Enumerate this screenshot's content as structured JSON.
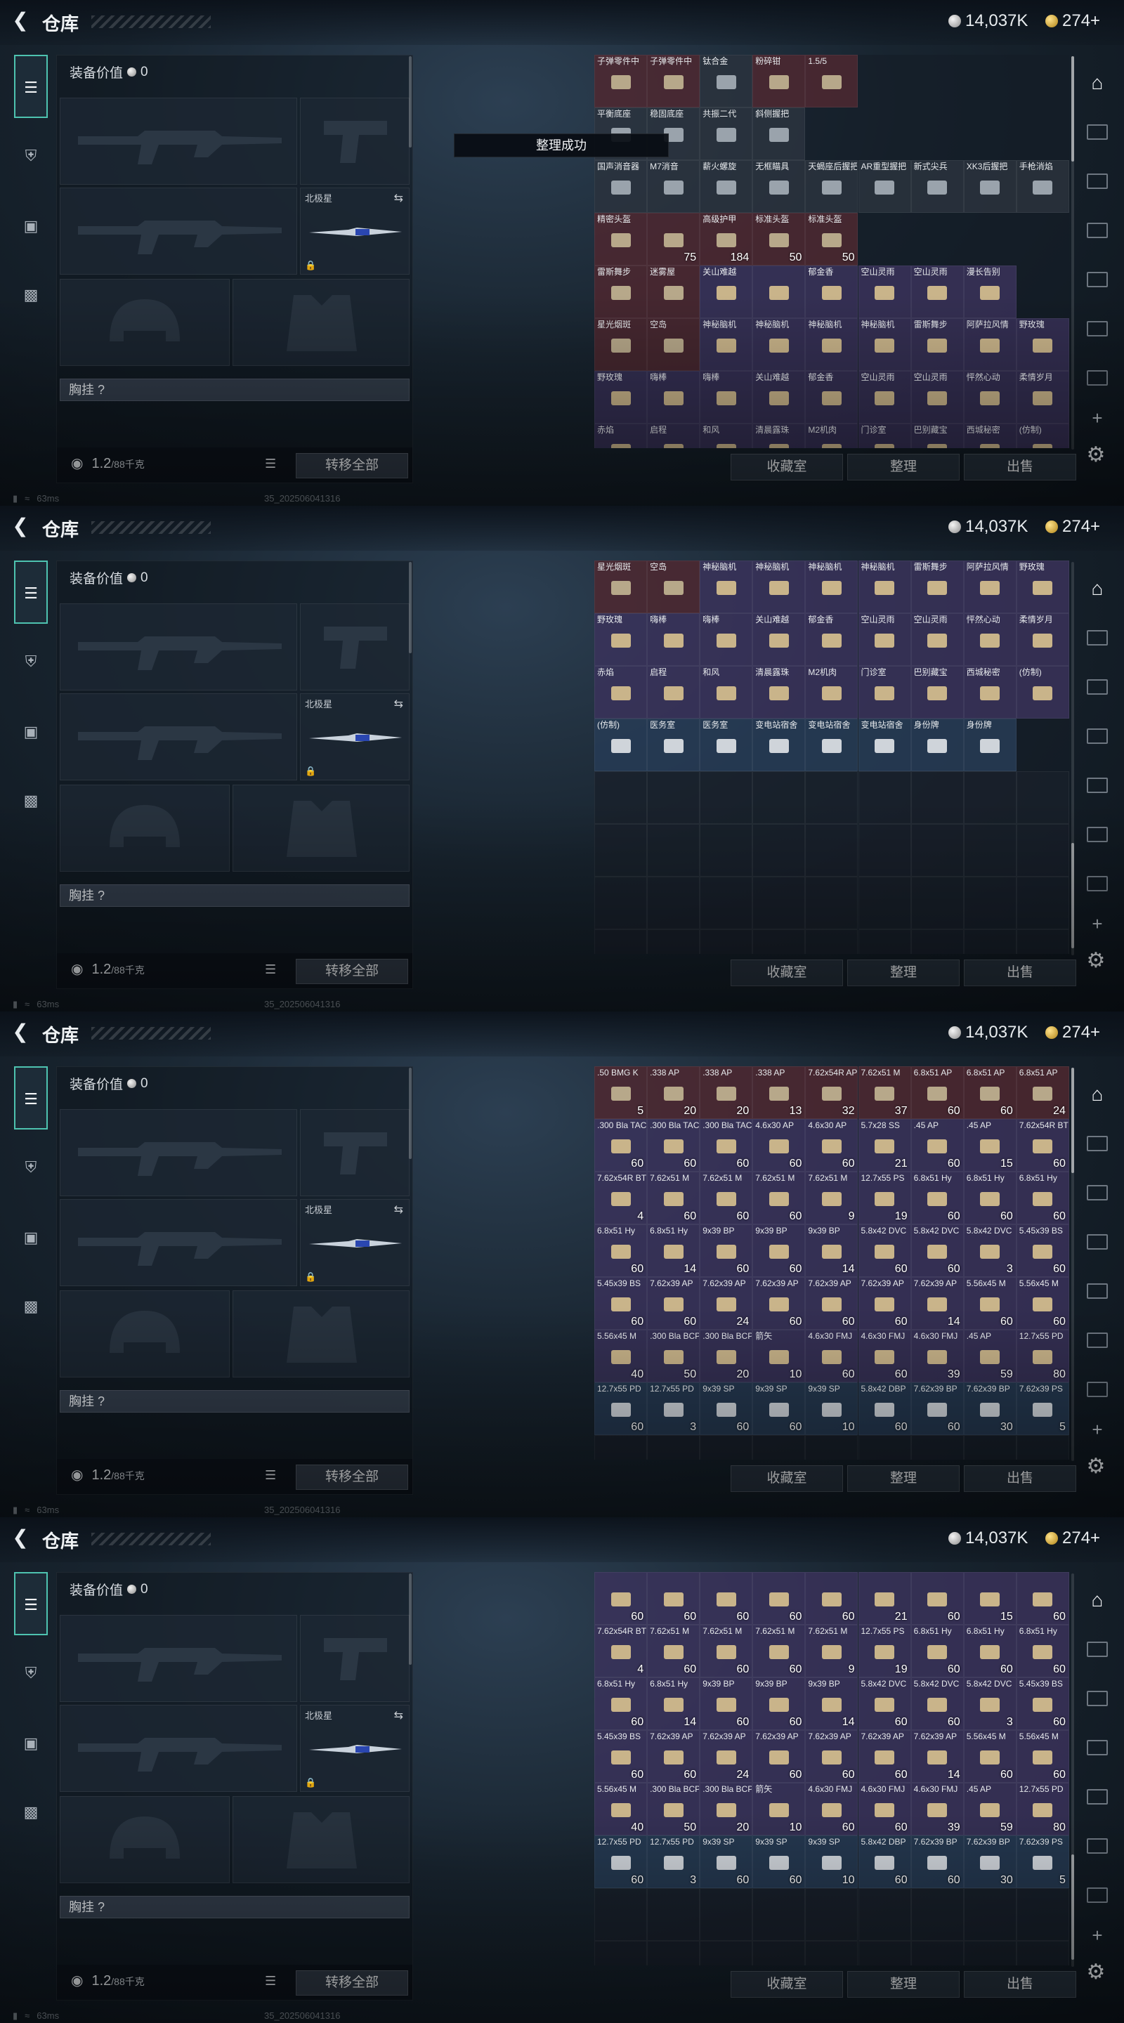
{
  "app": {
    "title": "仓库",
    "silver_amount": "14,037K",
    "gold_amount": "274+"
  },
  "equipment": {
    "value_label": "装备价值",
    "value_amount": "0",
    "compass_label": "北极星",
    "chest_rig_label": "胸挂 ?",
    "weight": "1.2",
    "weight_limit": "/88千克",
    "transfer_all_label": "转移全部"
  },
  "grid_buttons": {
    "collection_label": "收藏室",
    "sort_label": "整理",
    "sell_label": "出售"
  },
  "toast": {
    "text": "整理成功"
  },
  "status_bar": {
    "ping": "63ms",
    "build": "35_202506041316"
  },
  "colors": {
    "accent_teal": "#4ec3b0",
    "rarity_red": "#6e2e34",
    "rarity_purple": "#4e3e76",
    "rarity_blue": "#324c70",
    "rarity_gold": "#765c30"
  },
  "panels": [
    {
      "rows": [
        [
          "子弹零件中|red|",
          "子弹零件中|red|",
          "钛合金|gray|",
          "粉碎钳|red|",
          "1.5/5|red|"
        ],
        [
          "平衡底座|gray|",
          "稳固底座|gray|",
          "共振二代|gray|",
          "斜侧握把|gray|"
        ],
        [
          "国声消音器|gray|",
          "M7消音|gray|",
          "薪火螺旋|gray|",
          "无框瞄具|gray|",
          "天蝎座后握把|gray|",
          "AR重型握把|gray|",
          "新式尖兵|gray|",
          "XK3后握把|gray|",
          "手枪消焰|gray|"
        ],
        [
          "精密头盔|red|",
          "|red|75",
          "高级护甲|red|184",
          "标准头盔|red|50",
          "标准头盔|red|50"
        ],
        [
          "雷斯舞步|red|",
          "迷雾屋|red|",
          "关山难越|purple|",
          "|purple|",
          "郁金香|purple|",
          "空山灵雨|purple|",
          "空山灵雨|purple|",
          "漫长告别|purple|"
        ],
        [
          "星光烟斑|red|",
          "空岛|red|",
          "神秘脑机|purple|",
          "神秘脑机|purple|",
          "神秘脑机|purple|",
          "神秘脑机|purple|",
          "雷斯舞步|purple|",
          "阿萨拉风情|purple|",
          "野玫瑰|purple|"
        ],
        [
          "野玫瑰|purple|",
          "嗨棒|purple|",
          "嗨棒|purple|",
          "关山难越|purple|",
          "郁金香|purple|",
          "空山灵雨|purple|",
          "空山灵雨|purple|",
          "怦然心动|purple|",
          "柔情岁月|purple|"
        ],
        [
          "赤焰|purple|",
          "启程|purple|",
          "和风|purple|",
          "清晨露珠|purple|",
          "M2机肉|purple|",
          "门诊室|purple|",
          "巴别藏宝|purple|",
          "西城秘密|purple|",
          "(仿制)|purple|"
        ]
      ]
    },
    {
      "rows": [
        [
          "星光烟斑|red|",
          "空岛|red|",
          "神秘脑机|purple|",
          "神秘脑机|purple|",
          "神秘脑机|purple|",
          "神秘脑机|purple|",
          "雷斯舞步|purple|",
          "阿萨拉风情|purple|",
          "野玫瑰|purple|"
        ],
        [
          "野玫瑰|purple|",
          "嗨棒|purple|",
          "嗨棒|purple|",
          "关山难越|purple|",
          "郁金香|purple|",
          "空山灵雨|purple|",
          "空山灵雨|purple|",
          "怦然心动|purple|",
          "柔情岁月|purple|"
        ],
        [
          "赤焰|purple|",
          "启程|purple|",
          "和风|purple|",
          "清晨露珠|purple|",
          "M2机肉|purple|",
          "门诊室|purple|",
          "巴别藏宝|purple|",
          "西城秘密|purple|",
          "(仿制)|purple|"
        ],
        [
          "(仿制)|blue|",
          "医务室|blue|",
          "医务室|blue|",
          "变电站宿舍|blue|",
          "变电站宿舍|blue|",
          "变电站宿舍|blue|",
          "身份牌|blue|",
          "身份牌|blue|"
        ]
      ]
    },
    {
      "rows": [
        [
          ".50 BMG K|red|5",
          ".338 AP|red|20",
          ".338 AP|red|20",
          ".338 AP|red|13",
          "7.62x54R AP|red|32",
          "7.62x51 M|red|37",
          "6.8x51 AP|red|60",
          "6.8x51 AP|red|60",
          "6.8x51 AP|red|24"
        ],
        [
          ".300 Bla TAC|purple|60",
          ".300 Bla TAC|purple|60",
          ".300 Bla TAC|purple|60",
          "4.6x30 AP|purple|60",
          "4.6x30 AP|purple|60",
          "5.7x28 SS|purple|21",
          ".45 AP|purple|60",
          ".45 AP|purple|15",
          "7.62x54R BT|purple|60"
        ],
        [
          "7.62x54R BT|purple|4",
          "7.62x51 M|purple|60",
          "7.62x51 M|purple|60",
          "7.62x51 M|purple|60",
          "7.62x51 M|purple|9",
          "12.7x55 PS|purple|19",
          "6.8x51 Hy|purple|60",
          "6.8x51 Hy|purple|60",
          "6.8x51 Hy|purple|60"
        ],
        [
          "6.8x51 Hy|purple|60",
          "6.8x51 Hy|purple|14",
          "9x39 BP|purple|60",
          "9x39 BP|purple|60",
          "9x39 BP|purple|14",
          "5.8x42 DVC|purple|60",
          "5.8x42 DVC|purple|60",
          "5.8x42 DVC|purple|3",
          "5.45x39 BS|purple|60"
        ],
        [
          "5.45x39 BS|purple|60",
          "7.62x39 AP|purple|60",
          "7.62x39 AP|purple|24",
          "7.62x39 AP|purple|60",
          "7.62x39 AP|purple|60",
          "7.62x39 AP|purple|60",
          "7.62x39 AP|purple|14",
          "5.56x45 M|purple|60",
          "5.56x45 M|purple|60"
        ],
        [
          "5.56x45 M|purple|40",
          ".300 Bla BCP|purple|50",
          ".300 Bla BCP|purple|20",
          "箭矢|purple|10",
          "4.6x30 FMJ|purple|60",
          "4.6x30 FMJ|purple|60",
          "4.6x30 FMJ|purple|39",
          ".45 AP|purple|59",
          "12.7x55 PD|purple|80"
        ],
        [
          "12.7x55 PD|blue|60",
          "12.7x55 PD|blue|3",
          "9x39 SP|blue|60",
          "9x39 SP|blue|60",
          "9x39 SP|blue|10",
          "5.8x42 DBP|blue|60",
          "7.62x39 BP|blue|60",
          "7.62x39 BP|blue|30",
          "7.62x39 PS|blue|5"
        ]
      ]
    },
    {
      "rows": [
        [
          "|purple|60",
          "|purple|60",
          "|purple|60",
          "|purple|60",
          "|purple|60",
          "|purple|21",
          "|purple|60",
          "|purple|15",
          "|purple|60"
        ],
        [
          "7.62x54R BT|purple|4",
          "7.62x51 M|purple|60",
          "7.62x51 M|purple|60",
          "7.62x51 M|purple|60",
          "7.62x51 M|purple|9",
          "12.7x55 PS|purple|19",
          "6.8x51 Hy|purple|60",
          "6.8x51 Hy|purple|60",
          "6.8x51 Hy|purple|60"
        ],
        [
          "6.8x51 Hy|purple|60",
          "6.8x51 Hy|purple|14",
          "9x39 BP|purple|60",
          "9x39 BP|purple|60",
          "9x39 BP|purple|14",
          "5.8x42 DVC|purple|60",
          "5.8x42 DVC|purple|60",
          "5.8x42 DVC|purple|3",
          "5.45x39 BS|purple|60"
        ],
        [
          "5.45x39 BS|purple|60",
          "7.62x39 AP|purple|60",
          "7.62x39 AP|purple|24",
          "7.62x39 AP|purple|60",
          "7.62x39 AP|purple|60",
          "7.62x39 AP|purple|60",
          "7.62x39 AP|purple|14",
          "5.56x45 M|purple|60",
          "5.56x45 M|purple|60"
        ],
        [
          "5.56x45 M|purple|40",
          ".300 Bla BCP|purple|50",
          ".300 Bla BCP|purple|20",
          "箭矢|purple|10",
          "4.6x30 FMJ|purple|60",
          "4.6x30 FMJ|purple|60",
          "4.6x30 FMJ|purple|39",
          ".45 AP|purple|59",
          "12.7x55 PD|purple|80"
        ],
        [
          "12.7x55 PD|blue|60",
          "12.7x55 PD|blue|3",
          "9x39 SP|blue|60",
          "9x39 SP|blue|60",
          "9x39 SP|blue|10",
          "5.8x42 DBP|blue|60",
          "7.62x39 BP|blue|60",
          "7.62x39 BP|blue|30",
          "7.62x39 PS|blue|5"
        ]
      ]
    }
  ]
}
